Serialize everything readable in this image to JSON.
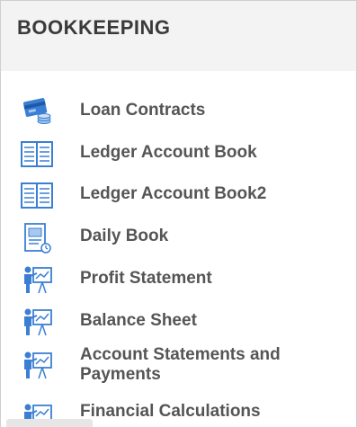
{
  "header": {
    "title": "BOOKKEEPING"
  },
  "menu": {
    "items": [
      {
        "label": "Loan Contracts",
        "icon": "loan-card-icon"
      },
      {
        "label": "Ledger Account Book",
        "icon": "ledger-book-icon"
      },
      {
        "label": "Ledger Account Book2",
        "icon": "ledger-book-icon"
      },
      {
        "label": "Daily Book",
        "icon": "daily-book-icon"
      },
      {
        "label": "Profit Statement",
        "icon": "presentation-icon"
      },
      {
        "label": "Balance Sheet",
        "icon": "presentation-icon"
      },
      {
        "label": "Account Statements and\nPayments",
        "icon": "presentation-icon"
      },
      {
        "label": "Financial Calculations",
        "icon": "presentation-icon"
      }
    ]
  },
  "colors": {
    "header_bg": "#f3f3f3",
    "title_text": "#3a3a3a",
    "item_text": "#555555",
    "icon_blue": "#3b7fd4",
    "icon_light_blue": "#a9c8ee"
  }
}
